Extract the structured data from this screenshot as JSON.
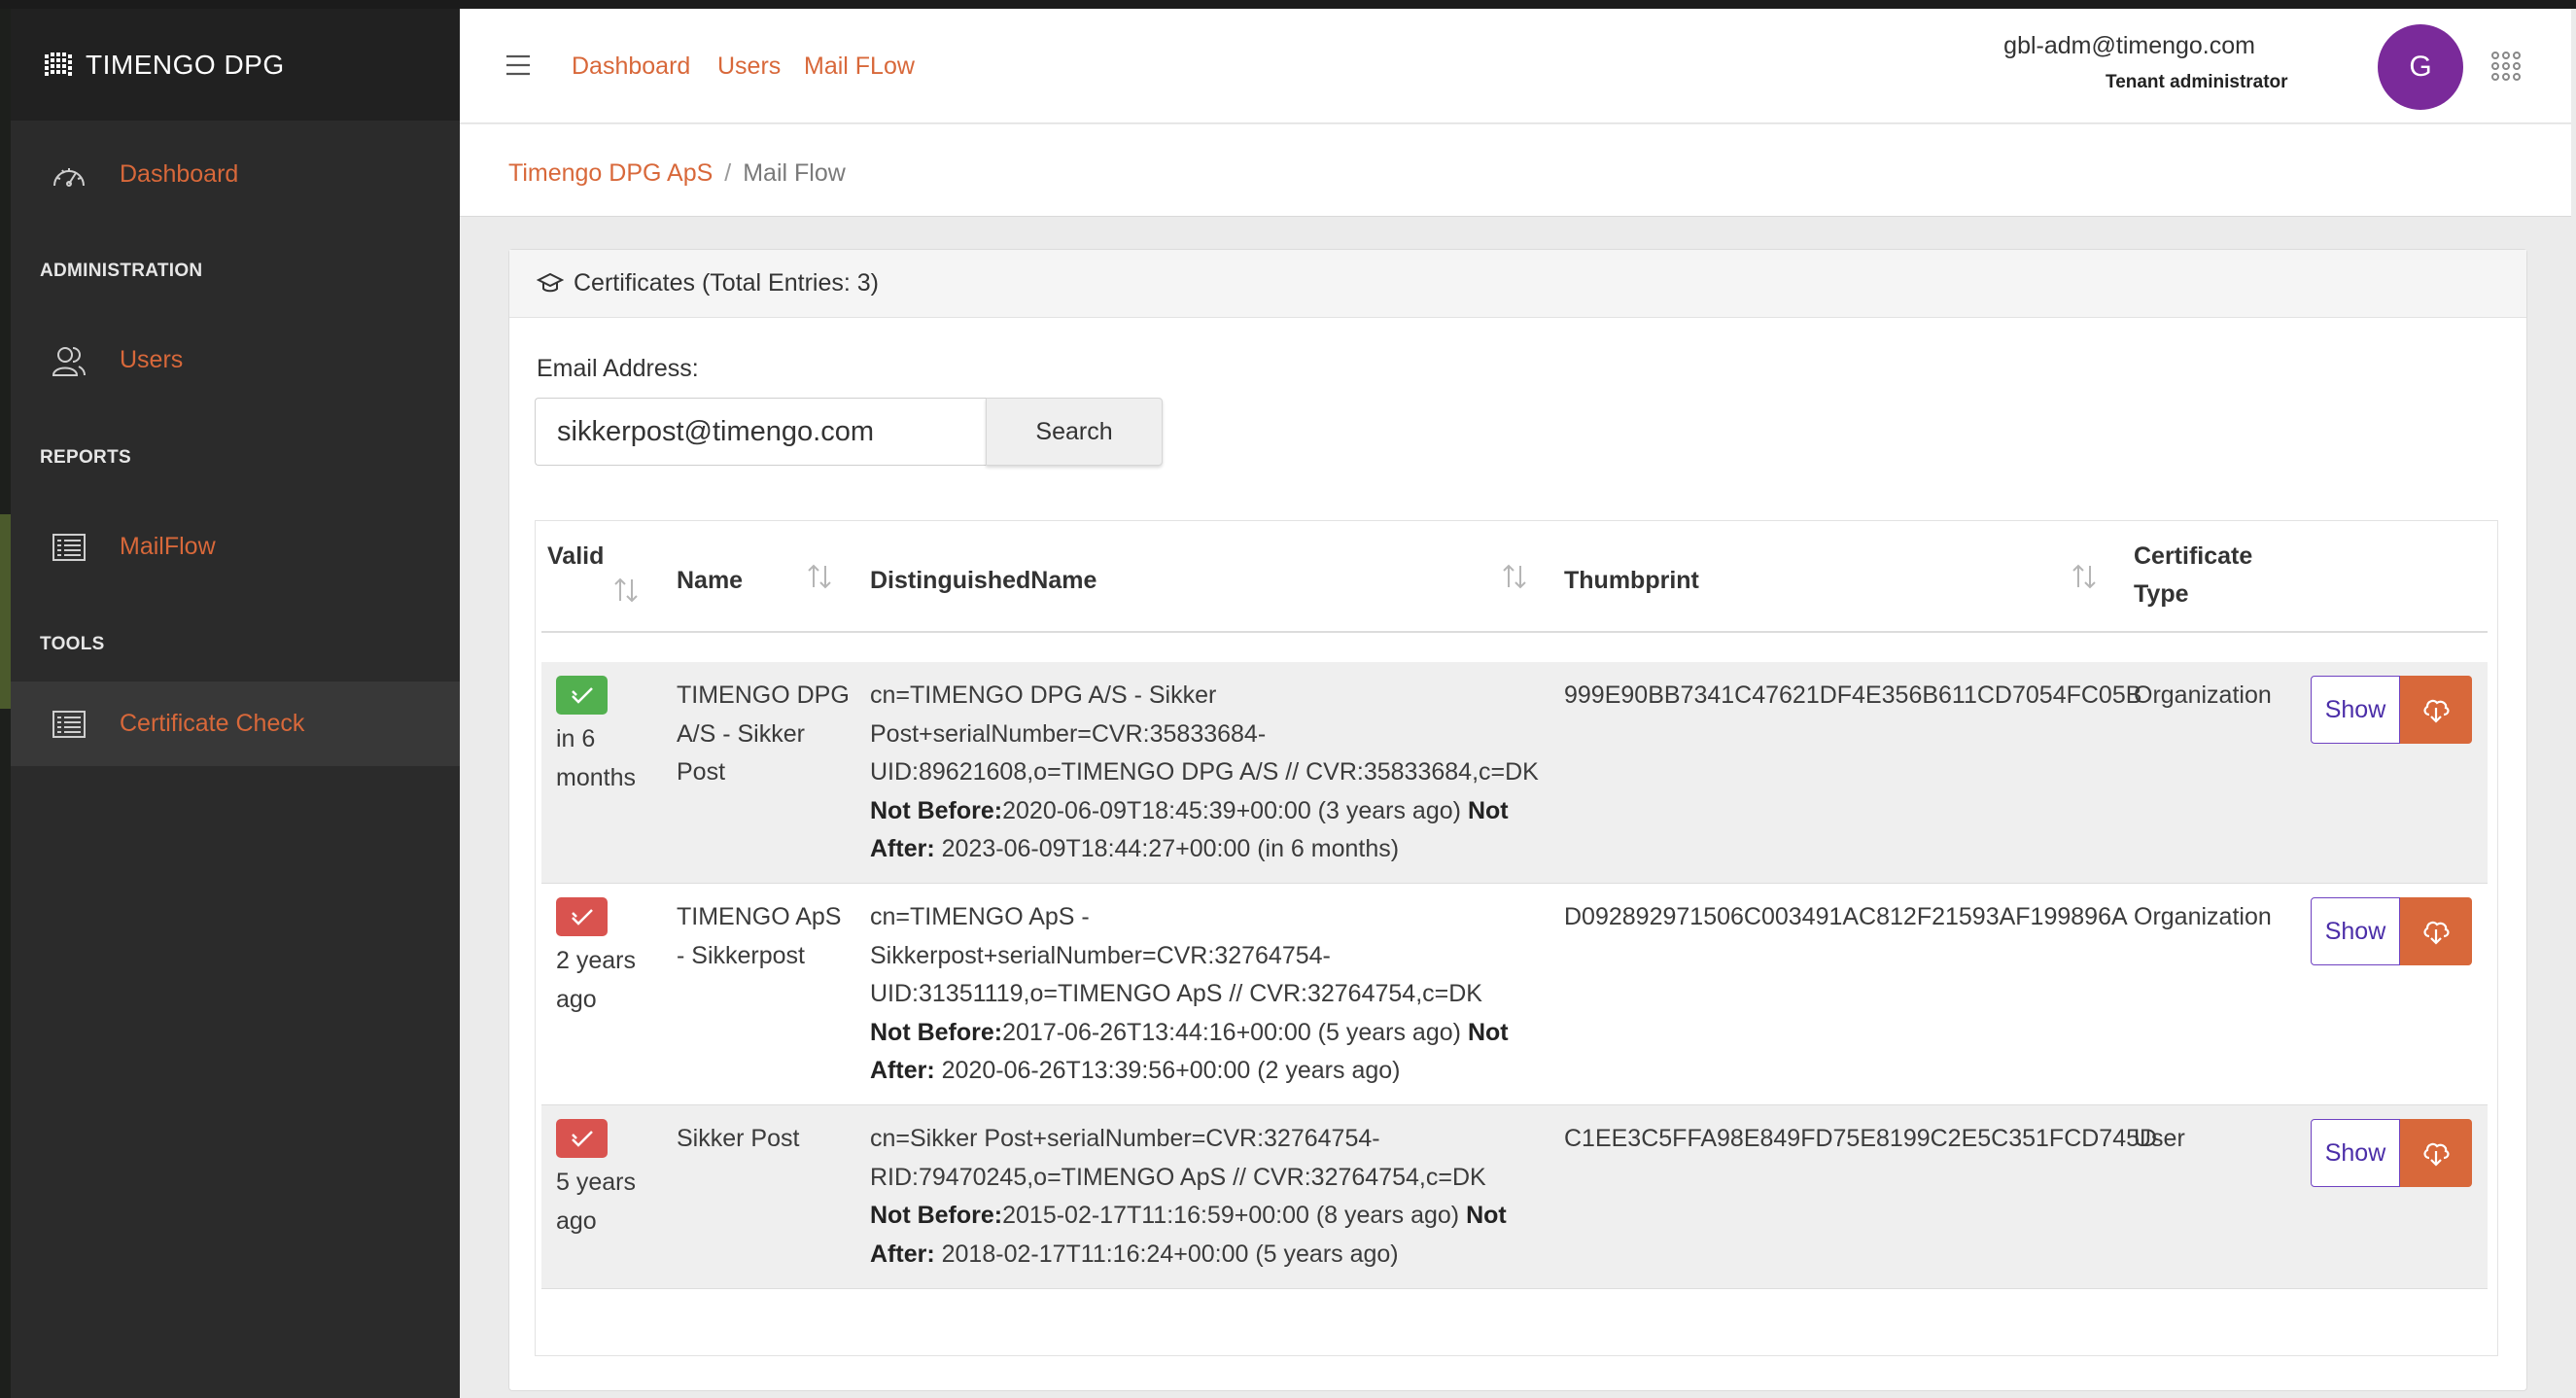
{
  "brand": {
    "name": "TIMENGO  DPG",
    "logo_icon": "grid-logo-icon"
  },
  "sidebar": {
    "dashboard": {
      "label": "Dashboard",
      "icon": "gauge-icon"
    },
    "administration_heading": "ADMINISTRATION",
    "users": {
      "label": "Users",
      "icon": "users-icon"
    },
    "reports_heading": "REPORTS",
    "mailflow": {
      "label": "MailFlow",
      "icon": "list-icon"
    },
    "tools_heading": "TOOLS",
    "certificate_check": {
      "label": "Certificate Check",
      "icon": "list-icon"
    }
  },
  "topbar": {
    "menu_icon": "hamburger-icon",
    "links": [
      "Dashboard",
      "Users",
      "Mail FLow"
    ],
    "user_email": "gbl-adm@timengo.com",
    "user_role": "Tenant administrator",
    "avatar_letter": "G",
    "apps_icon": "apps-grid-icon"
  },
  "breadcrumb": {
    "parent": "Timengo DPG ApS",
    "separator": "/",
    "current": "Mail Flow"
  },
  "card": {
    "icon": "graduation-cap-icon",
    "title": "Certificates (Total Entries: 3)",
    "email_label": "Email Address:",
    "email_value": "sikkerpost@timengo.com",
    "search_label": "Search"
  },
  "table": {
    "headers": {
      "valid": "Valid",
      "name": "Name",
      "distinguished_name": "DistinguishedName",
      "thumbprint": "Thumbprint",
      "certificate_type_1": "Certificate",
      "certificate_type_2": "Type"
    },
    "show_label": "Show",
    "rows": [
      {
        "status": "valid",
        "valid_l1": "in 6",
        "valid_l2": "months",
        "name_l1": "TIMENGO DPG",
        "name_l2": "A/S - Sikker",
        "name_l3": "Post",
        "dn_l1": "cn=TIMENGO DPG A/S - Sikker",
        "dn_l2": "Post+serialNumber=CVR:35833684-",
        "dn_l3": "UID:89621608,o=TIMENGO DPG A/S // CVR:35833684,c=DK",
        "not_before_label": "Not Before:",
        "not_before": "2020-06-09T18:45:39+00:00 (3 years ago)",
        "not_after_label_1": "Not",
        "not_after_label_2": "After:",
        "not_after": "2023-06-09T18:44:27+00:00 (in 6 months)",
        "thumbprint": "999E90BB7341C47621DF4E356B611CD7054FC05B",
        "type": "Organization"
      },
      {
        "status": "expired",
        "valid_l1": "2 years",
        "valid_l2": "ago",
        "name_l1": "TIMENGO ApS",
        "name_l2": "- Sikkerpost",
        "dn_l1": "cn=TIMENGO ApS -",
        "dn_l2": "Sikkerpost+serialNumber=CVR:32764754-",
        "dn_l3": "UID:31351119,o=TIMENGO ApS // CVR:32764754,c=DK",
        "not_before_label": "Not Before:",
        "not_before": "2017-06-26T13:44:16+00:00 (5 years ago)",
        "not_after_label_1": "Not",
        "not_after_label_2": "After:",
        "not_after": "2020-06-26T13:39:56+00:00 (2 years ago)",
        "thumbprint": "D092892971506C003491AC812F21593AF199896A",
        "type": "Organization"
      },
      {
        "status": "expired",
        "valid_l1": "5 years",
        "valid_l2": "ago",
        "name_l1": "Sikker Post",
        "dn_l1": "cn=Sikker Post+serialNumber=CVR:32764754-",
        "dn_l2": "RID:79470245,o=TIMENGO ApS // CVR:32764754,c=DK",
        "not_before_label": "Not Before:",
        "not_before": "2015-02-17T11:16:59+00:00 (8 years ago)",
        "not_after_label_1": "Not",
        "not_after_label_2": "After:",
        "not_after": "2018-02-17T11:16:24+00:00 (5 years ago)",
        "thumbprint": "C1EE3C5FFA98E849FD75E8199C2E5C351FCD745D",
        "type": "User"
      }
    ]
  },
  "colors": {
    "accent": "#d8683a",
    "sidebar_bg": "#2b2b2b",
    "valid_badge": "#52b04f",
    "expired_badge": "#d9534f",
    "avatar": "#7a2a9a",
    "show_button_border": "#6f42c1"
  }
}
